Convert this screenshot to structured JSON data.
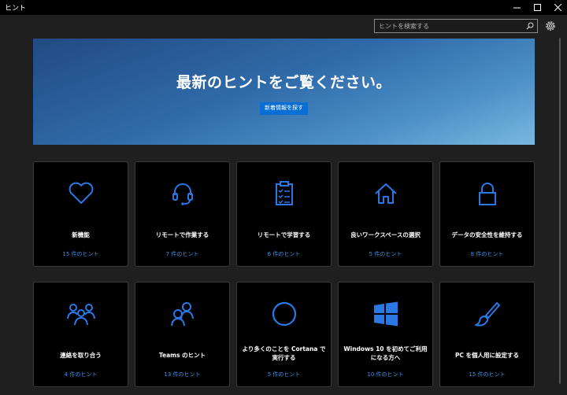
{
  "window": {
    "title": "ヒント"
  },
  "search": {
    "placeholder": "ヒントを検索する"
  },
  "hero": {
    "headline": "最新のヒントをご覧ください。",
    "button_label": "新着情報を探す"
  },
  "colors": {
    "accent": "#2b78e4",
    "count_text": "#3b8fe6",
    "card_bg": "#000000",
    "page_bg": "#1f1f1f"
  },
  "cards": [
    {
      "title": "新機能",
      "count": "15 件のヒント",
      "icon": "heart-icon"
    },
    {
      "title": "リモートで作業する",
      "count": "7 件のヒント",
      "icon": "headset-icon"
    },
    {
      "title": "リモートで学習する",
      "count": "6 件のヒント",
      "icon": "clipboard-checklist-icon"
    },
    {
      "title": "良いワークスペースの選択",
      "count": "5 件のヒント",
      "icon": "home-icon"
    },
    {
      "title": "データの安全性を維持する",
      "count": "8 件のヒント",
      "icon": "lock-icon"
    },
    {
      "title": "連絡を取り合う",
      "count": "4 件のヒント",
      "icon": "people-group-icon"
    },
    {
      "title": "Teams のヒント",
      "count": "13 件のヒント",
      "icon": "two-people-icon"
    },
    {
      "title": "より多くのことを Cortana で実行する",
      "count": "5 件のヒント",
      "icon": "cortana-circle-icon"
    },
    {
      "title": "Windows 10 を初めてご利用になる方へ",
      "count": "10 件のヒント",
      "icon": "windows-logo-icon"
    },
    {
      "title": "PC を個人用に設定する",
      "count": "15 件のヒント",
      "icon": "brush-icon"
    }
  ]
}
